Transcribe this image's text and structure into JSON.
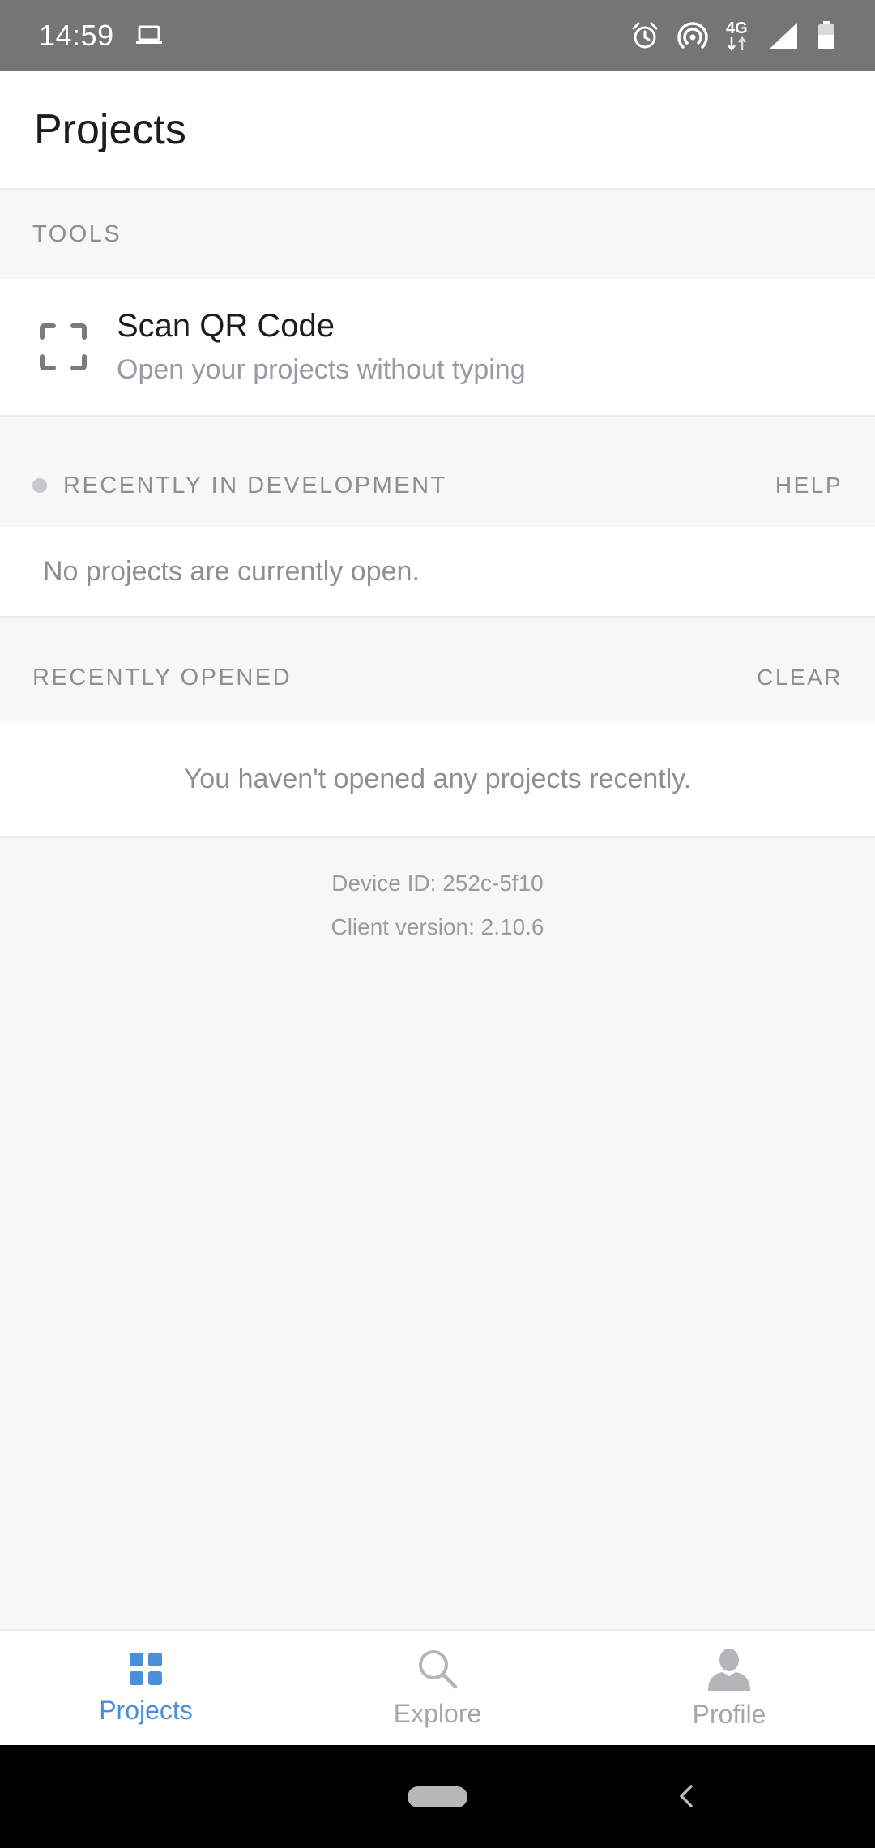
{
  "status_bar": {
    "time": "14:59",
    "network_label": "4G",
    "icons": [
      "laptop-icon",
      "alarm-icon",
      "hotspot-icon",
      "network-4g-icon",
      "signal-icon",
      "battery-icon"
    ]
  },
  "header": {
    "title": "Projects"
  },
  "tools": {
    "label": "TOOLS",
    "scan": {
      "title": "Scan QR Code",
      "subtitle": "Open your projects without typing",
      "icon": "scan-frame-icon"
    }
  },
  "recently_in_development": {
    "label": "RECENTLY IN DEVELOPMENT",
    "action": "HELP",
    "empty_text": "No projects are currently open."
  },
  "recently_opened": {
    "label": "RECENTLY OPENED",
    "action": "CLEAR",
    "empty_text": "You haven't opened any projects recently."
  },
  "meta": {
    "device_id": "Device ID: 252c-5f10",
    "client_version": "Client version: 2.10.6"
  },
  "tabs": [
    {
      "label": "Projects",
      "icon": "grid-icon",
      "active": true
    },
    {
      "label": "Explore",
      "icon": "search-icon",
      "active": false
    },
    {
      "label": "Profile",
      "icon": "person-icon",
      "active": false
    }
  ],
  "colors": {
    "accent": "#4a90d9",
    "status_bar": "#757575",
    "background": "#f7f7f7",
    "muted_text": "#8e8e93"
  }
}
